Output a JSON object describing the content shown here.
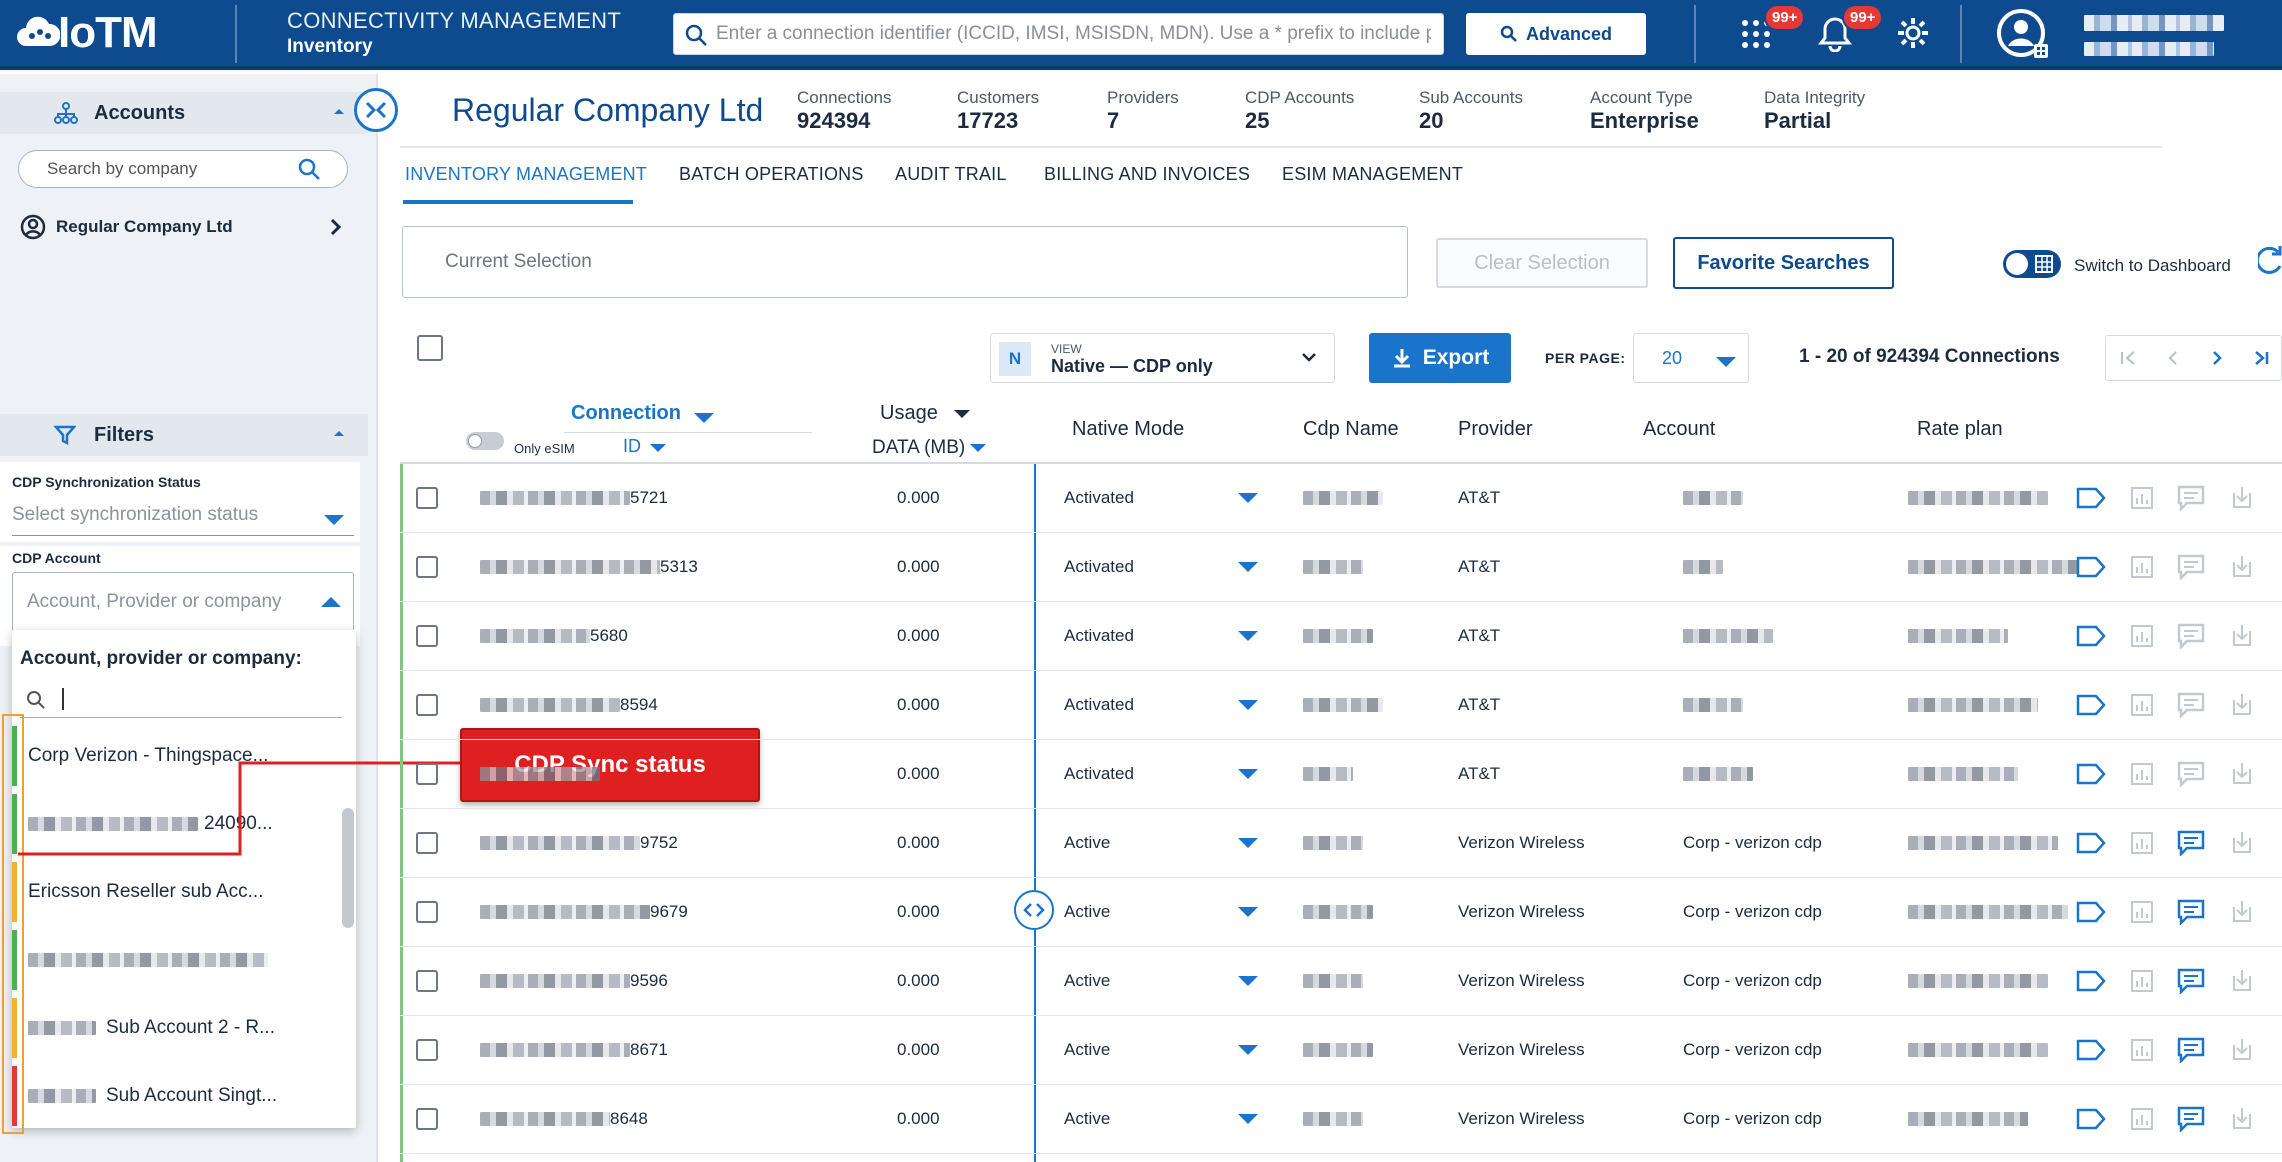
{
  "header": {
    "logo_text": "IoTM",
    "title": "CONNECTIVITY MANAGEMENT",
    "subtitle": "Inventory",
    "search_placeholder": "Enter a connection identifier (ICCID, IMSI, MSISDN, MDN). Use a * prefix to include partial matches",
    "advanced_label": "Advanced",
    "apps_badge": "99+",
    "notifications_badge": "99+",
    "brand_color": "#0d4a8e"
  },
  "sidebar": {
    "accounts_title": "Accounts",
    "search_placeholder": "Search by company",
    "company": "Regular Company Ltd",
    "filters_title": "Filters",
    "sync_label": "CDP Synchronization Status",
    "sync_placeholder": "Select synchronization status",
    "cdp_account_label": "CDP Account",
    "cdp_account_placeholder": "Account, Provider or company",
    "dropdown_heading": "Account, provider or company:",
    "dropdown_items": [
      {
        "text": "Corp Verizon - Thingspace...",
        "status_color": "#4caf50"
      },
      {
        "text": "24090...",
        "status_color": "#4caf50"
      },
      {
        "text": "Ericsson Reseller sub Acc...",
        "status_color": "#f0b429"
      },
      {
        "text": "",
        "status_color": "#4caf50"
      },
      {
        "text": "Sub Account 2 - R...",
        "status_color": "#f0b429"
      },
      {
        "text": "Sub Account Singt...",
        "status_color": "#e53935"
      }
    ]
  },
  "callout": {
    "label": "CDP Sync status",
    "color": "#e02020"
  },
  "main": {
    "company_title": "Regular Company Ltd",
    "stats": [
      {
        "label": "Connections",
        "value": "924394"
      },
      {
        "label": "Customers",
        "value": "17723"
      },
      {
        "label": "Providers",
        "value": "7"
      },
      {
        "label": "CDP Accounts",
        "value": "25"
      },
      {
        "label": "Sub Accounts",
        "value": "20"
      },
      {
        "label": "Account Type",
        "value": "Enterprise"
      },
      {
        "label": "Data Integrity",
        "value": "Partial"
      }
    ],
    "tabs": [
      "INVENTORY MANAGEMENT",
      "BATCH OPERATIONS",
      "AUDIT TRAIL",
      "BILLING AND INVOICES",
      "ESIM MANAGEMENT"
    ],
    "active_tab": "INVENTORY MANAGEMENT",
    "current_selection_placeholder": "Current Selection",
    "clear_selection": "Clear Selection",
    "favorite_searches": "Favorite Searches",
    "switch_dashboard": "Switch to Dashboard",
    "view_label": "VIEW",
    "view_badge": "N",
    "view_value": "Native — CDP only",
    "export_label": "Export",
    "per_page_label": "PER PAGE:",
    "per_page_value": "20",
    "pagination": "1 - 20 of 924394 Connections"
  },
  "table": {
    "col_connection": "Connection",
    "col_id": "ID",
    "only_esim": "Only eSIM",
    "col_usage": "Usage",
    "col_data": "DATA (MB)",
    "col_native_mode": "Native Mode",
    "col_cdp_name": "Cdp Name",
    "col_provider": "Provider",
    "col_account": "Account",
    "col_rate_plan": "Rate plan",
    "rows": [
      {
        "id_suffix": "5721",
        "usage": "0.000",
        "mode": "Activated",
        "provider": "AT&T",
        "account": "",
        "comment_active": false
      },
      {
        "id_suffix": "5313",
        "usage": "0.000",
        "mode": "Activated",
        "provider": "AT&T",
        "account": "",
        "comment_active": false
      },
      {
        "id_suffix": "5680",
        "usage": "0.000",
        "mode": "Activated",
        "provider": "AT&T",
        "account": "",
        "comment_active": false
      },
      {
        "id_suffix": "8594",
        "usage": "0.000",
        "mode": "Activated",
        "provider": "AT&T",
        "account": "",
        "comment_active": false
      },
      {
        "id_suffix": "",
        "usage": "0.000",
        "mode": "Activated",
        "provider": "AT&T",
        "account": "",
        "comment_active": false
      },
      {
        "id_suffix": "9752",
        "usage": "0.000",
        "mode": "Active",
        "provider": "Verizon Wireless",
        "account": "Corp - verizon cdp",
        "comment_active": true
      },
      {
        "id_suffix": "9679",
        "usage": "0.000",
        "mode": "Active",
        "provider": "Verizon Wireless",
        "account": "Corp - verizon cdp",
        "comment_active": true
      },
      {
        "id_suffix": "9596",
        "usage": "0.000",
        "mode": "Active",
        "provider": "Verizon Wireless",
        "account": "Corp - verizon cdp",
        "comment_active": true
      },
      {
        "id_suffix": "8671",
        "usage": "0.000",
        "mode": "Active",
        "provider": "Verizon Wireless",
        "account": "Corp - verizon cdp",
        "comment_active": true
      },
      {
        "id_suffix": "8648",
        "usage": "0.000",
        "mode": "Active",
        "provider": "Verizon Wireless",
        "account": "Corp - verizon cdp",
        "comment_active": true
      }
    ]
  }
}
